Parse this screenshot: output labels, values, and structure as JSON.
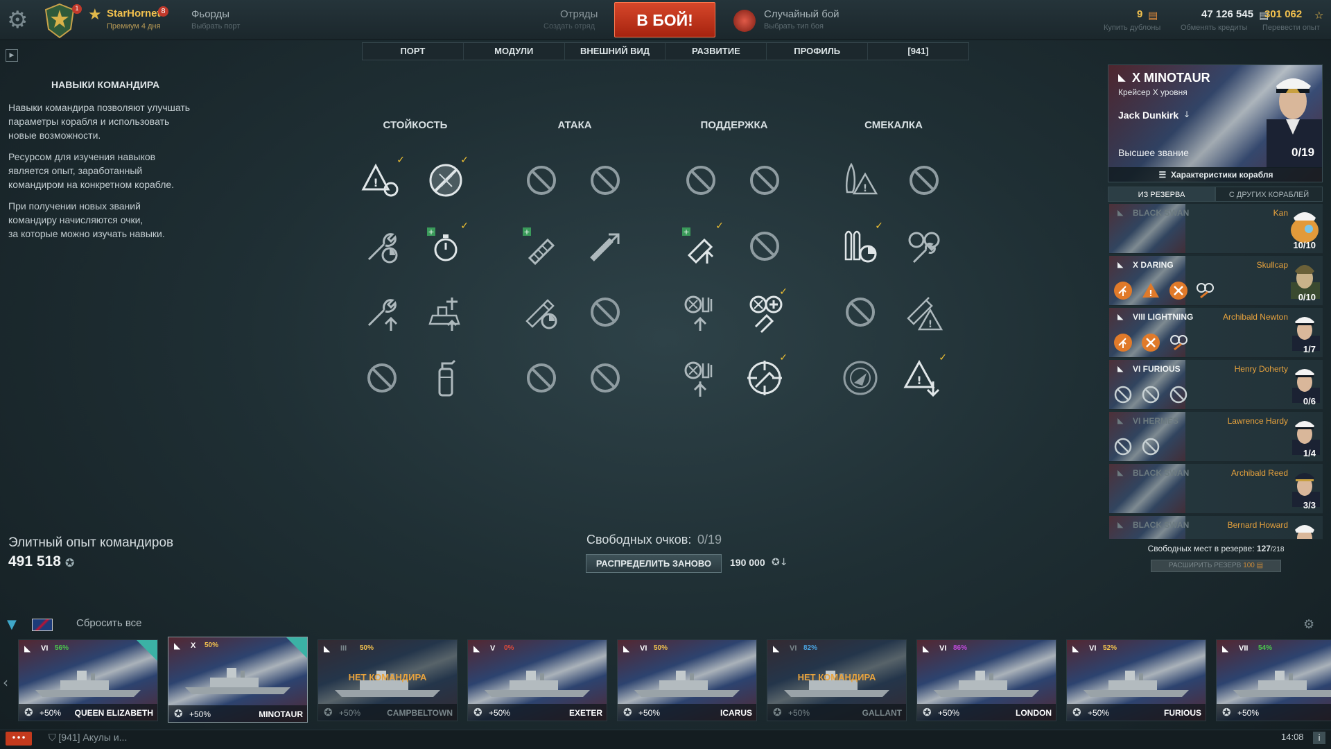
{
  "topbar": {
    "player_name": "StarHornet",
    "player_badge": "8",
    "player_sub": "Премиум 4 дня",
    "port_title": "Фьорды",
    "port_sub": "Выбрать порт",
    "squad_title": "Отряды",
    "squad_sub": "Создать отряд",
    "battle_label": "В БОЙ!",
    "mode_title": "Случайный бой",
    "mode_sub": "Выбрать тип боя",
    "doubloons": "9",
    "doubloons_sub": "Купить дублоны",
    "credits": "47 126 545",
    "credits_sub": "Обменять кредиты",
    "free_xp": "301 062",
    "free_xp_sub": "Перевести опыт"
  },
  "tabs": [
    "ПОРТ",
    "МОДУЛИ",
    "ВНЕШНИЙ ВИД",
    "РАЗВИТИЕ",
    "ПРОФИЛЬ",
    "[941]"
  ],
  "left_panel": {
    "title": "НАВЫКИ КОМАНДИРА",
    "paragraphs": [
      [
        "Навыки командира позволяют улучшать",
        "параметры корабля и использовать",
        "новые возможности."
      ],
      [
        "Ресурсом для изучения навыков",
        "является опыт, заработанный",
        "командиром на конкретном корабле."
      ],
      [
        "При получении новых званий",
        "командиру начисляются очки,",
        "за которые можно изучать навыки."
      ]
    ],
    "elite_label": "Элитный опыт командиров",
    "elite_value": "491 518"
  },
  "skills": {
    "columns": [
      "СТОЙКОСТЬ",
      "АТАКА",
      "ПОДДЕРЖКА",
      "СМЕКАЛКА"
    ]
  },
  "center_bottom": {
    "free_points_label": "Свободных очков:",
    "free_points_value": "0/19",
    "redistribute_label": "РАСПРЕДЕЛИТЬ ЗАНОВО",
    "redistribute_cost": "190 000"
  },
  "commander_card": {
    "ship": "X MINOTAUR",
    "ship_class": "Крейсер X уровня",
    "name": "Jack Dunkirk",
    "rank": "Высшее звание",
    "points": "0/19",
    "details_button": "Характеристики корабля"
  },
  "reserve_tabs": [
    "ИЗ РЕЗЕРВА",
    "С ДРУГИХ КОРАБЛЕЙ"
  ],
  "reserve": [
    {
      "ship": "BLACK SWAN",
      "name": "Kan",
      "points": "10/10",
      "dim": true
    },
    {
      "ship": "X DARING",
      "name": "Skullcap",
      "points": "0/10",
      "dim": false
    },
    {
      "ship": "VIII LIGHTNING",
      "name": "Archibald Newton",
      "points": "1/7",
      "dim": false
    },
    {
      "ship": "VI FURIOUS",
      "name": "Henry Doherty",
      "points": "0/6",
      "dim": false
    },
    {
      "ship": "VI HERMES",
      "name": "Lawrence Hardy",
      "points": "1/4",
      "dim": true
    },
    {
      "ship": "BLACK SWAN",
      "name": "Archibald Reed",
      "points": "3/3",
      "dim": true
    },
    {
      "ship": "BLACK SWAN",
      "name": "Bernard Howard",
      "points": "",
      "dim": true
    }
  ],
  "reserve_free_label": "Свободных мест в резерве:",
  "reserve_free_value": "127",
  "reserve_free_total": "/218",
  "reserve_expand": "РАСШИРИТЬ РЕЗЕРВ",
  "reserve_expand_cost": "100",
  "carousel": {
    "reset_label": "Сбросить все",
    "ships": [
      {
        "tier": "VI",
        "pct": "56%",
        "bonus": "+50%",
        "name": "QUEEN ELIZABETH",
        "nocmd": "",
        "dim": false,
        "sel": false,
        "pct_color": "#4cc54c"
      },
      {
        "tier": "X",
        "pct": "50%",
        "bonus": "+50%",
        "name": "MINOTAUR",
        "nocmd": "",
        "dim": false,
        "sel": true,
        "pct_color": "#f2c14e"
      },
      {
        "tier": "III",
        "pct": "50%",
        "bonus": "+50%",
        "name": "CAMPBELTOWN",
        "nocmd": "НЕТ КОМАНДИРА",
        "dim": true,
        "sel": false,
        "pct_color": "#f2c14e"
      },
      {
        "tier": "V",
        "pct": "0%",
        "bonus": "+50%",
        "name": "EXETER",
        "nocmd": "",
        "dim": false,
        "sel": false,
        "pct_color": "#e04a3a"
      },
      {
        "tier": "VI",
        "pct": "50%",
        "bonus": "+50%",
        "name": "ICARUS",
        "nocmd": "",
        "dim": false,
        "sel": false,
        "pct_color": "#f2c14e"
      },
      {
        "tier": "VI",
        "pct": "82%",
        "bonus": "+50%",
        "name": "GALLANT",
        "nocmd": "НЕТ КОМАНДИРА",
        "dim": true,
        "sel": false,
        "pct_color": "#4aa3e0"
      },
      {
        "tier": "VI",
        "pct": "86%",
        "bonus": "+50%",
        "name": "LONDON",
        "nocmd": "",
        "dim": false,
        "sel": false,
        "pct_color": "#c04ad8"
      },
      {
        "tier": "VI",
        "pct": "52%",
        "bonus": "+50%",
        "name": "FURIOUS",
        "nocmd": "",
        "dim": false,
        "sel": false,
        "pct_color": "#f2c14e"
      },
      {
        "tier": "VII",
        "pct": "54%",
        "bonus": "+50%",
        "name": "",
        "nocmd": "",
        "dim": false,
        "sel": false,
        "pct_color": "#4cc54c"
      }
    ]
  },
  "bottombar": {
    "chat_text": "[941] Акулы и...",
    "clock": "14:08",
    "chat_button": "•••",
    "info_button": "i"
  },
  "colors": {
    "accent_gold": "#f2c14e",
    "battle_red": "#c43a1d",
    "commander_orange": "#e8a33d",
    "check_yellow": "#f1c232"
  }
}
